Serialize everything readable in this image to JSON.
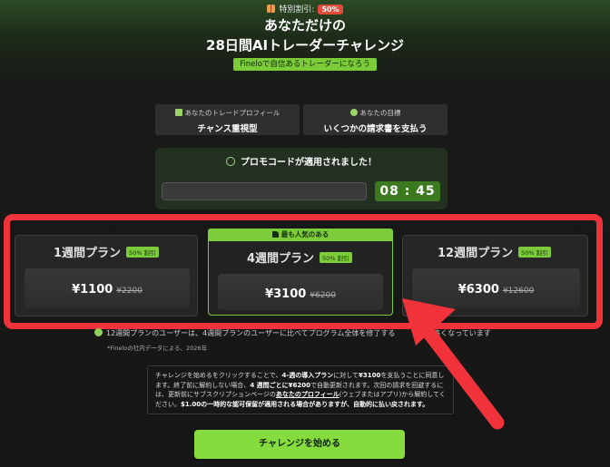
{
  "header": {
    "badge_label": "特別割引:",
    "badge_pct": "50%",
    "title_line1": "あなただけの",
    "title_line2": "28日間AIトレーダーチャレンジ",
    "tagline": "Fineloで自信あるトレーダーになろう"
  },
  "profile": {
    "profile_label": "あなたのトレードプロフィール",
    "profile_value": "チャンス重視型",
    "goal_label": "あなたの目標",
    "goal_value": "いくつかの請求書を支払う"
  },
  "promo": {
    "message": "プロモコードが適用されました！",
    "timer": "08 : 45"
  },
  "plans": [
    {
      "name": "1週間プラン",
      "discount": "50% 割引",
      "price": "¥1100",
      "old_price": "¥2200"
    },
    {
      "name": "4週間プラン",
      "discount": "50% 割引",
      "price": "¥3100",
      "old_price": "¥6200",
      "badge": "最も人気のある"
    },
    {
      "name": "12週間プラン",
      "discount": "50% 割引",
      "price": "¥6300",
      "old_price": "¥12600"
    }
  ],
  "note": {
    "text": "12週間プランのユーザーは、4週間プランのユーザーに比べてプログラム全体を修了する",
    "text_end": "23%高くなっています",
    "source": "*Fineloの社内データによる、2026年"
  },
  "terms": {
    "p1": "チャレンジを始めるをクリックすることで、",
    "p2": "4-週の導入プラン",
    "p3": "に対して",
    "p4": "¥3100",
    "p5": "を支払うことに同意します。終了前に解約しない場合、",
    "p6": "4 週間ごとに¥6200",
    "p7": "で自動更新されます。次回の請求を回避するには、更新前にサブスクリプションページの",
    "p8": "あなたのプロフィール",
    "p9": "(ウェブまたはアプリ)から解約してください。",
    "p10": "$1.00の一時的な認可保留が適用される場合がありますが、自動的に払い戻されます。"
  },
  "cta": {
    "label": "チャレンジを始める"
  },
  "colors": {
    "accent": "#86dc3f",
    "highlight": "#f0333a"
  }
}
